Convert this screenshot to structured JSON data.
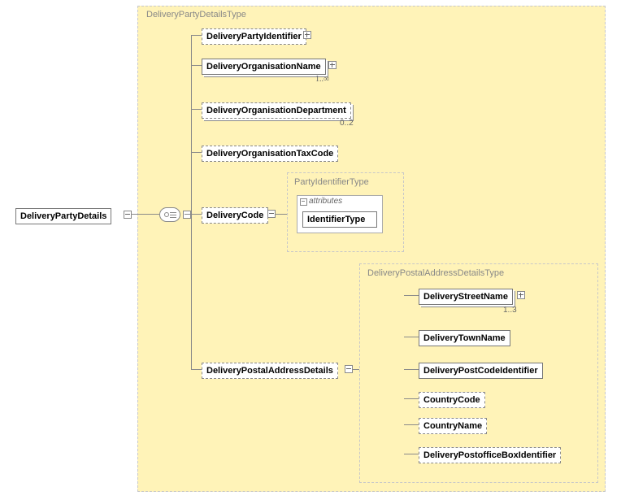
{
  "root": {
    "label": "DeliveryPartyDetails"
  },
  "mainGroup": {
    "label": "DeliveryPartyDetailsType"
  },
  "children": {
    "partyIdentifier": {
      "label": "DeliveryPartyIdentifier"
    },
    "orgName": {
      "label": "DeliveryOrganisationName",
      "cardinality": "1..∞"
    },
    "orgDept": {
      "label": "DeliveryOrganisationDepartment",
      "cardinality": "0..2"
    },
    "orgTaxCode": {
      "label": "DeliveryOrganisationTaxCode"
    },
    "deliveryCode": {
      "label": "DeliveryCode"
    },
    "postalDetails": {
      "label": "DeliveryPostalAddressDetails"
    }
  },
  "partyIdType": {
    "label": "PartyIdentifierType",
    "attributesLabel": "attributes",
    "identifierType": "IdentifierType"
  },
  "postalGroup": {
    "label": "DeliveryPostalAddressDetailsType",
    "streetName": {
      "label": "DeliveryStreetName",
      "cardinality": "1..3"
    },
    "townName": {
      "label": "DeliveryTownName"
    },
    "postCode": {
      "label": "DeliveryPostCodeIdentifier"
    },
    "countryCode": {
      "label": "CountryCode"
    },
    "countryName": {
      "label": "CountryName"
    },
    "poBox": {
      "label": "DeliveryPostofficeBoxIdentifier"
    }
  }
}
